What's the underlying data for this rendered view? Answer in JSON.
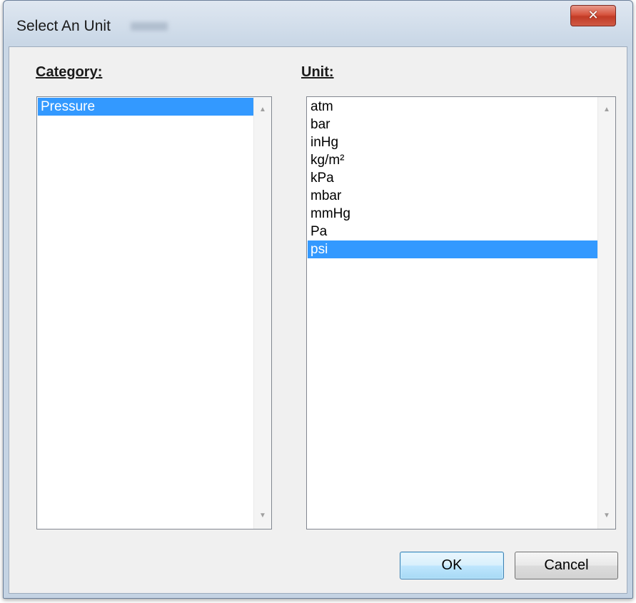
{
  "window": {
    "title": "Select An Unit",
    "close_glyph": "✕"
  },
  "category": {
    "label": "Category:",
    "items": [
      "Pressure"
    ],
    "selected_index": 0
  },
  "unit": {
    "label": "Unit:",
    "items": [
      "atm",
      "bar",
      "inHg",
      "kg/m²",
      "kPa",
      "mbar",
      "mmHg",
      "Pa",
      "psi"
    ],
    "selected_index": 8
  },
  "buttons": {
    "ok_label": "OK",
    "cancel_label": "Cancel"
  },
  "icons": {
    "scroll_up": "▲",
    "scroll_down": "▼"
  },
  "colors": {
    "selection": "#3399ff",
    "close_button": "#c23b26"
  }
}
